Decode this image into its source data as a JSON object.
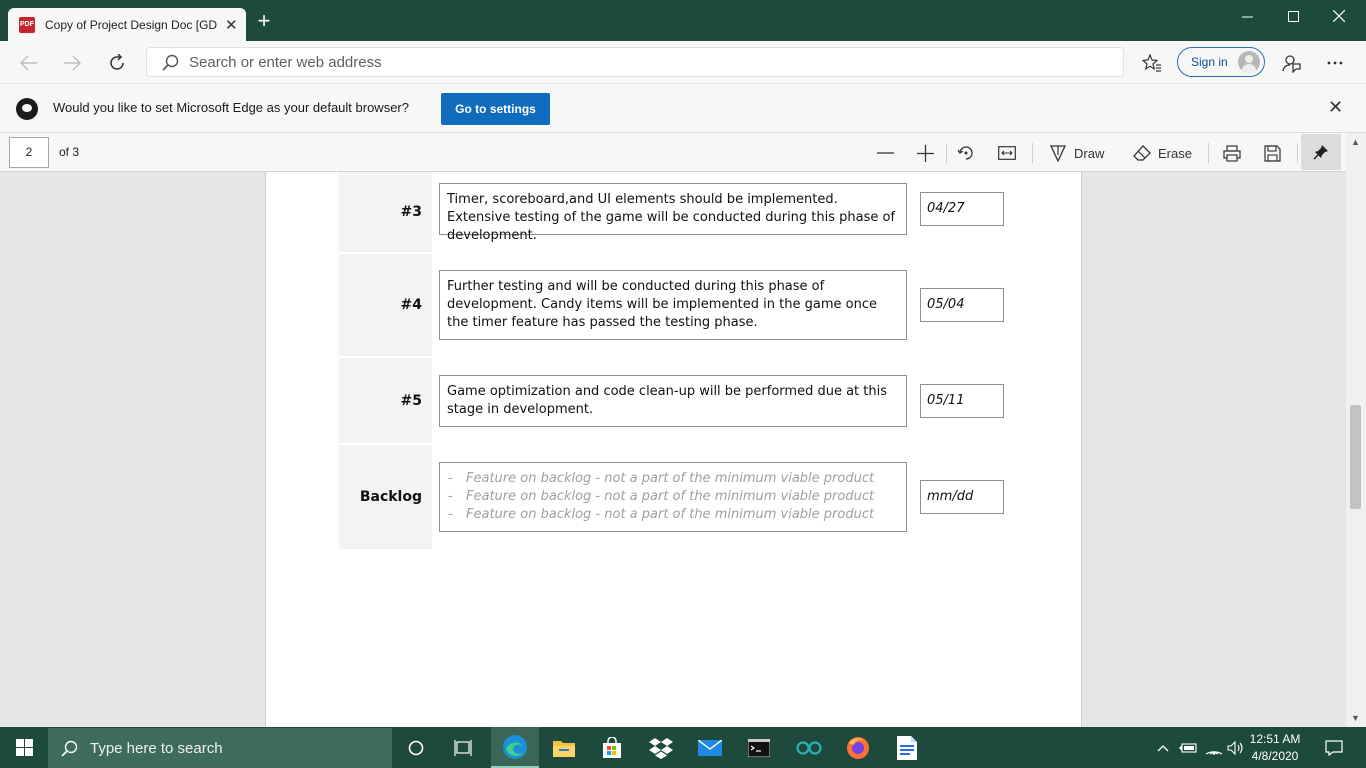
{
  "browser": {
    "tab_title": "Copy of Project Design Doc [GDC",
    "tab_icon_text": "PDF",
    "address_placeholder": "Search or enter web address",
    "signin_label": "Sign in"
  },
  "infobar": {
    "message": "Would you like to set Microsoft Edge as your default browser?",
    "button_label": "Go to settings"
  },
  "pdf_toolbar": {
    "page_number": "2",
    "page_count": "of 3",
    "draw_label": "Draw",
    "erase_label": "Erase"
  },
  "document": {
    "rows": [
      {
        "label": "#3",
        "description": "Timer, scoreboard,and UI elements should be implemented. Extensive testing of the game will be conducted during this phase of development.",
        "date": "04/27"
      },
      {
        "label": "#4",
        "description": "Further testing and will be conducted during this phase of development. Candy items will be implemented in the game once the timer feature has passed the testing phase.",
        "date": "05/04"
      },
      {
        "label": "#5",
        "description": "Game optimization and code clean-up will be performed due at this stage in development.",
        "date": "05/11"
      }
    ],
    "backlog": {
      "label": "Backlog",
      "items": [
        "Feature on backlog - not a part of the minimum viable product",
        "Feature on backlog - not a part of the minimum viable product",
        "Feature on backlog - not a part of the minimum viable product"
      ],
      "bullet": "-",
      "date": "mm/dd"
    }
  },
  "taskbar": {
    "search_placeholder": "Type here to search",
    "time": "12:51 AM",
    "date": "4/8/2020"
  },
  "colors": {
    "titlebar": "#1e4a3e",
    "accent_button": "#0f6cbd",
    "taskbar": "#1e4a3e"
  }
}
